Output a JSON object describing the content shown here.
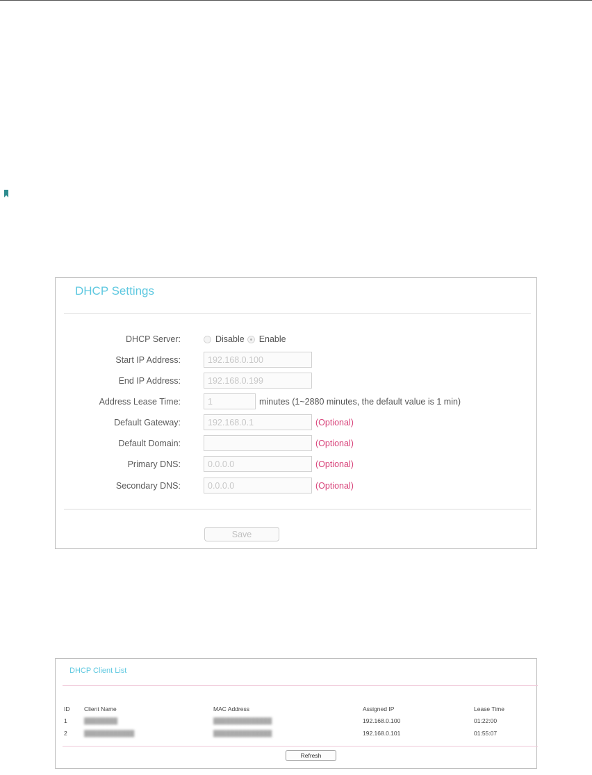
{
  "settings": {
    "title": "DHCP Settings",
    "dhcp_server": {
      "label": "DHCP Server:",
      "option_disable": "Disable",
      "option_enable": "Enable",
      "selected": "Enable"
    },
    "start_ip": {
      "label": "Start IP Address:",
      "value": "192.168.0.100"
    },
    "end_ip": {
      "label": "End IP Address:",
      "value": "192.168.0.199"
    },
    "lease_time": {
      "label": "Address Lease Time:",
      "value": "1",
      "note": "minutes (1~2880 minutes, the default value is 1 min)"
    },
    "gateway": {
      "label": "Default Gateway:",
      "value": "192.168.0.1",
      "optional": "(Optional)"
    },
    "domain": {
      "label": "Default Domain:",
      "value": "",
      "optional": "(Optional)"
    },
    "primary_dns": {
      "label": "Primary DNS:",
      "value": "0.0.0.0",
      "optional": "(Optional)"
    },
    "secondary_dns": {
      "label": "Secondary DNS:",
      "value": "0.0.0.0",
      "optional": "(Optional)"
    },
    "save_label": "Save"
  },
  "client_list": {
    "title": "DHCP Client List",
    "headers": {
      "id": "ID",
      "name": "Client Name",
      "mac": "MAC Address",
      "ip": "Assigned IP",
      "lease": "Lease Time"
    },
    "rows": [
      {
        "id": "1",
        "name": "",
        "mac": "",
        "ip": "192.168.0.100",
        "lease": "01:22:00"
      },
      {
        "id": "2",
        "name": "",
        "mac": "",
        "ip": "192.168.0.101",
        "lease": "01:55:07"
      }
    ],
    "refresh_label": "Refresh"
  },
  "colors": {
    "title": "#5ec8e0",
    "optional": "#d8437a",
    "bookmark": "#2e8c8f"
  }
}
